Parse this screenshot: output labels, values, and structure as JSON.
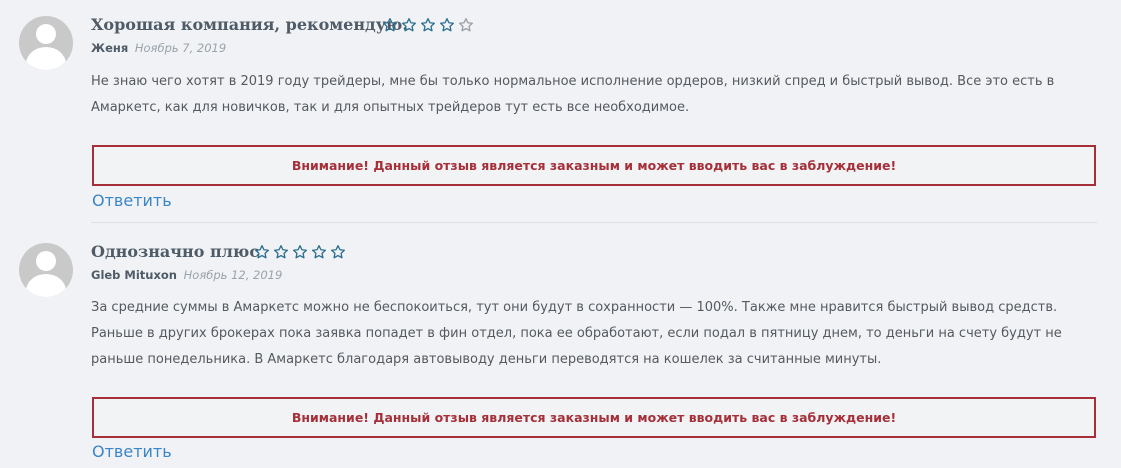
{
  "reviews": [
    {
      "title": "Хорошая компания, рекомендую.",
      "rating": 4,
      "max_rating": 5,
      "author": "Женя",
      "date": "Ноябрь 7, 2019",
      "text": "Не знаю чего хотят в 2019 году трейдеры, мне бы только нормальное исполнение ордеров, низкий спред и быстрый вывод. Все это есть в Амаркетс, как для новичков, так и для опытных трейдеров тут есть все необходимое.",
      "warning": "Внимание! Данный отзыв является заказным и может вводить вас в заблуждение!",
      "reply_label": "Ответить"
    },
    {
      "title": "Однозначно плюс",
      "rating": 0,
      "max_rating": 5,
      "author": "Gleb Mituxon",
      "date": "Ноябрь 12, 2019",
      "text": "За средние суммы в Амаркетс можно не беспокоиться, тут они будут в сохранности — 100%. Также мне нравится быстрый вывод средств. Раньше в других брокерах пока заявка попадет в фин отдел, пока ее обработают, если подал в пятницу днем, то деньги на счету будут не раньше понедельника. В Амаркетс благодаря автовыводу деньги переводятся на кошелек за считанные минуты.",
      "warning": "Внимание! Данный отзыв является заказным и может вводить вас в заблуждение!",
      "reply_label": "Ответить"
    }
  ],
  "colors": {
    "star_active": "#2e6f8e",
    "star_inactive": "#9aa0a6",
    "warning": "#a6303a",
    "link": "#3a86c8"
  },
  "icons": {
    "avatar": "default-user-avatar-icon",
    "star": "star-outline-icon"
  }
}
